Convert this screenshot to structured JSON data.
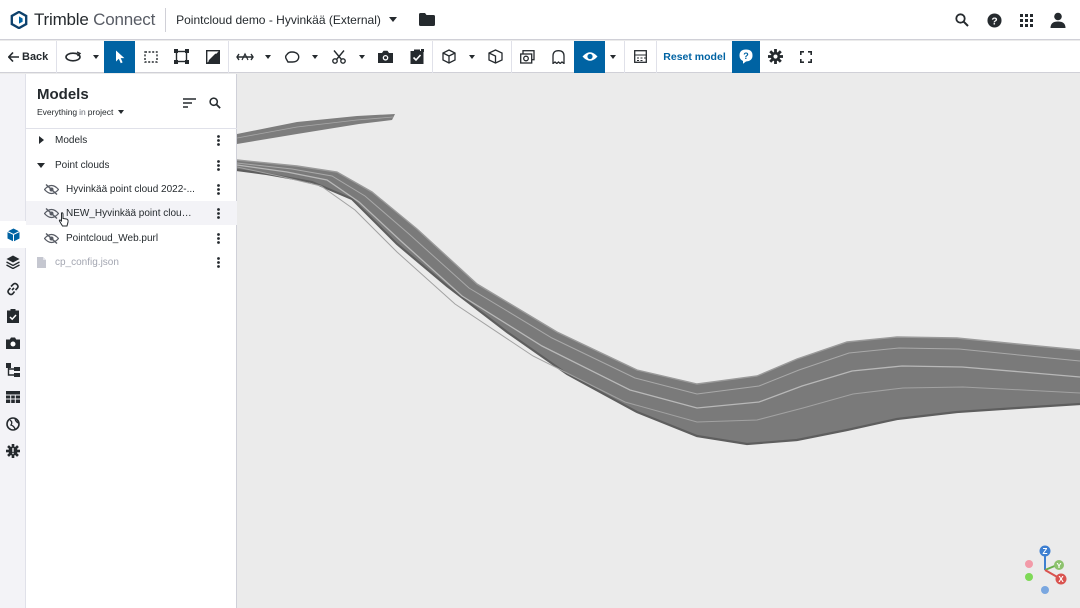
{
  "header": {
    "brand_primary": "Trimble",
    "brand_secondary": "Connect",
    "project_name": "Pointcloud demo - Hyvinkää (External)",
    "icons": [
      "trimble-logo-icon",
      "caret-down-icon",
      "folder-icon",
      "search-icon",
      "help-icon",
      "apps-grid-icon",
      "user-icon"
    ]
  },
  "toolbar": {
    "back_label": "Back",
    "reset_label": "Reset model",
    "accent_color": "#0063a3",
    "tools": [
      "orbit",
      "select",
      "area-select",
      "fit-to-view",
      "ortho",
      "measure",
      "markup",
      "cut",
      "snapshot",
      "add-todo",
      "3d-view",
      "section",
      "xray",
      "ghost",
      "visibility",
      "minimap",
      "reset-model",
      "help",
      "settings",
      "fullscreen"
    ]
  },
  "rail": {
    "items": [
      "models-icon",
      "layers-icon",
      "link-icon",
      "todo-icon",
      "camera-icon",
      "hierarchy-icon",
      "table-icon",
      "global-icon",
      "extensions-icon"
    ]
  },
  "panel": {
    "title": "Models",
    "filter_scope": "Everything",
    "filter_in": "in",
    "filter_target": "project",
    "tree": [
      {
        "label": "Models",
        "type": "folder",
        "expanded": false
      },
      {
        "label": "Point clouds",
        "type": "folder",
        "expanded": true
      },
      {
        "label": "Hyvinkää point cloud 2022-...",
        "type": "pointcloud",
        "visible": false
      },
      {
        "label": "NEW_Hyvinkää point cloud ...",
        "type": "pointcloud",
        "visible": false,
        "hovered": true
      },
      {
        "label": "Pointcloud_Web.purl",
        "type": "pointcloud",
        "visible": false
      },
      {
        "label": "cp_config.json",
        "type": "file",
        "muted": true
      }
    ]
  },
  "viewport": {
    "background": "#ebebeb",
    "road_color": "#7a7a7a",
    "axis_labels": {
      "z": "Z",
      "y": "Y",
      "x": "X"
    }
  }
}
